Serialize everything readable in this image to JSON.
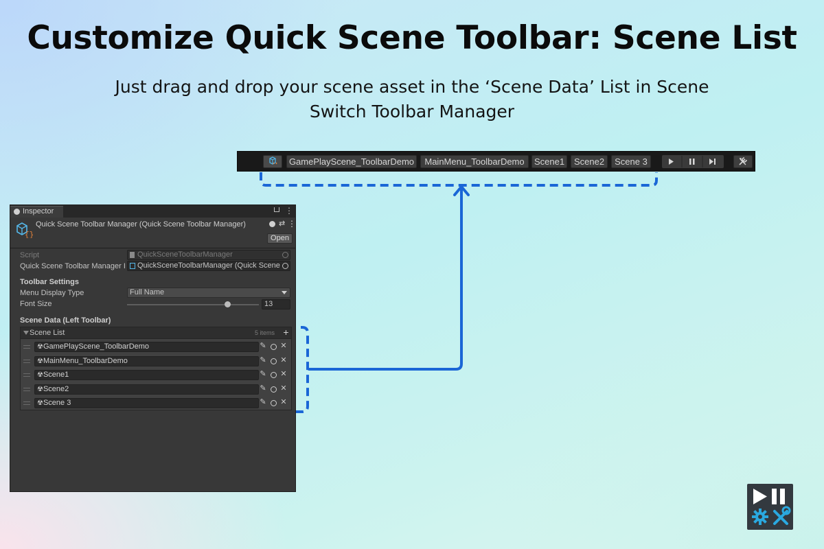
{
  "hero": {
    "title": "Customize Quick Scene Toolbar: Scene List",
    "subtitle_line1": "Just drag and drop your scene asset in the ‘Scene Data’ List in Scene",
    "subtitle_line2": "Switch Toolbar Manager"
  },
  "toolbar": {
    "scenes": [
      "GamePlayScene_ToolbarDemo",
      "MainMenu_ToolbarDemo",
      "Scene1",
      "Scene2",
      "Scene 3"
    ],
    "icons": [
      "package-icon",
      "play-icon",
      "pause-icon",
      "step-icon",
      "tools-icon"
    ]
  },
  "inspector": {
    "tab_label": "Inspector",
    "component_title": "Quick Scene Toolbar Manager (Quick Scene Toolbar Manager)",
    "open_button": "Open",
    "script_label": "Script",
    "script_value": "QuickSceneToolbarManager",
    "manager_label": "Quick Scene Toolbar Manager I",
    "manager_value": "QuickSceneToolbarManager (Quick Scene",
    "toolbar_settings_header": "Toolbar Settings",
    "menu_display_type_label": "Menu Display Type",
    "menu_display_type_value": "Full Name",
    "font_size_label": "Font Size",
    "font_size_value": "13",
    "font_size_fraction": 0.76,
    "scene_data_header": "Scene Data (Left Toolbar)",
    "scene_list_label": "Scene List",
    "scene_list_count": "5 items",
    "scene_list": [
      "GamePlayScene_ToolbarDemo",
      "MainMenu_ToolbarDemo",
      "Scene1",
      "Scene2",
      "Scene 3"
    ]
  },
  "colors": {
    "accent_blue": "#1a66d6",
    "toolbar_bg": "#191919",
    "inspector_bg": "#383838",
    "logo_bg": "#33393f",
    "logo_blue": "#2aa9e0"
  }
}
